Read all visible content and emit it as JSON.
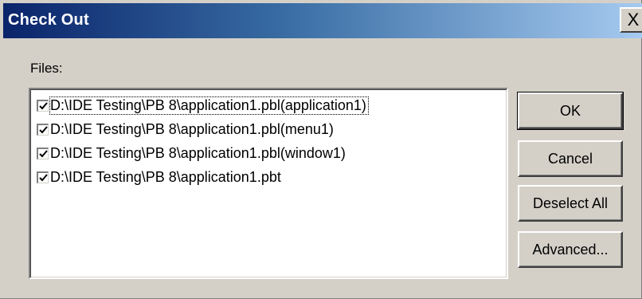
{
  "dialog": {
    "title": "Check Out",
    "close_icon": "close-icon",
    "close_glyph": "X"
  },
  "files": {
    "label": "Files:",
    "items": [
      {
        "path": "D:\\IDE Testing\\PB 8\\application1.pbl(application1)",
        "checked": true
      },
      {
        "path": "D:\\IDE Testing\\PB 8\\application1.pbl(menu1)",
        "checked": true
      },
      {
        "path": "D:\\IDE Testing\\PB 8\\application1.pbl(window1)",
        "checked": true
      },
      {
        "path": "D:\\IDE Testing\\PB 8\\application1.pbt",
        "checked": true
      }
    ]
  },
  "buttons": {
    "ok": "OK",
    "cancel": "Cancel",
    "deselect_all": "Deselect All",
    "advanced": "Advanced..."
  },
  "colors": {
    "title_start": "#0a246a",
    "title_end": "#a6caf0",
    "face": "#d4d0c8"
  }
}
